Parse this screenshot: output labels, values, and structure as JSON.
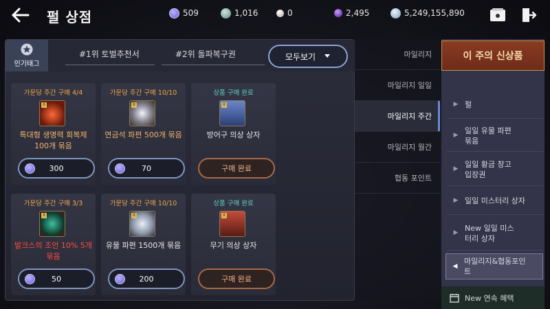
{
  "header": {
    "title": "펄 상점",
    "currencies": [
      {
        "icon": "mileage-coin-icon",
        "value": "509",
        "color": "#7a6fd8"
      },
      {
        "icon": "silver-stone-icon",
        "value": "1,016",
        "color": "#7ea79a"
      },
      {
        "icon": "pearl-icon",
        "value": "0",
        "color": "#d9c8c8"
      },
      {
        "icon": "purple-orb-icon",
        "value": "2,495",
        "color": "#7a3fc8"
      },
      {
        "icon": "silver-coin-icon",
        "value": "5,249,155,890",
        "color": "#a9c2d8"
      }
    ]
  },
  "tags": {
    "popular_label": "인기태그",
    "items": [
      "#1위 토벌추천서",
      "#2위 돌파복구권"
    ],
    "view_all": "모두보기"
  },
  "products": [
    {
      "limit": "가문당 주간 구매 4/4",
      "limit_color": "#f0a848",
      "name": "특대형 생명력 회복제 100개 묶음",
      "name_style": "gold",
      "status": "price",
      "price": "300",
      "icon": "potion-icon"
    },
    {
      "limit": "가문당 주간 구매 10/10",
      "limit_color": "#f0a848",
      "name": "연금석 파편 500개 묶음",
      "name_style": "gold",
      "status": "price",
      "price": "70",
      "icon": "alchemy-stone-icon"
    },
    {
      "limit": "상품 구매 완료",
      "limit_color": "#5fd0c8",
      "name": "방어구 의상 상자",
      "name_style": "white",
      "status": "done",
      "done_label": "구매 완료",
      "icon": "armor-box-icon"
    },
    {
      "limit": "가문당 주간 구매 3/3",
      "limit_color": "#f0a848",
      "name": "발크스의 조언 10% 5개 묶음",
      "name_style": "red",
      "status": "price",
      "price": "50",
      "icon": "valks-advice-icon"
    },
    {
      "limit": "가문당 주간 구매 10/10",
      "limit_color": "#f0a848",
      "name": "유물 파편 1500개 묶음",
      "name_style": "white",
      "status": "price",
      "price": "200",
      "icon": "relic-shard-icon"
    },
    {
      "limit": "상품 구매 완료",
      "limit_color": "#5fd0c8",
      "name": "무기 의상 상자",
      "name_style": "white",
      "status": "done",
      "done_label": "구매 완료",
      "icon": "weapon-box-icon"
    }
  ],
  "side_menu": {
    "items": [
      "마일리지",
      "마일리지 일일",
      "마일리지 주간",
      "마일리지 월간",
      "협동 포인트"
    ],
    "active": "마일리지 주간"
  },
  "right_list": {
    "banner": "이 주의 신상품",
    "items": [
      "펄",
      "일일 유물 파편 묶음",
      "일일 황금 창고 입장권",
      "일일 미스터리 상자",
      "New 일일 미스터리 상자",
      "마일리지&협동포인트"
    ],
    "selected": "마일리지&협동포인트",
    "footer": "New 연속 혜택"
  }
}
